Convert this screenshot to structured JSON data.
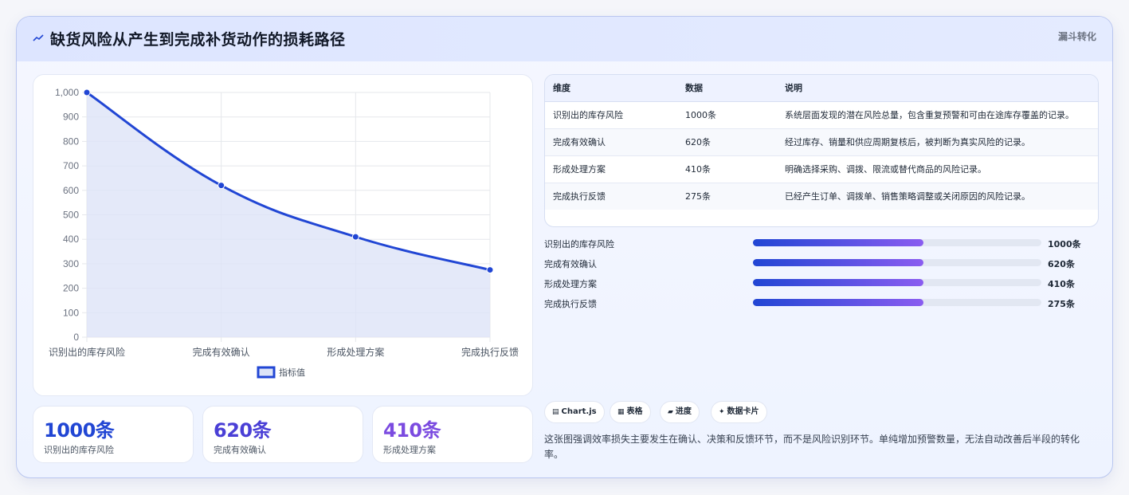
{
  "header": {
    "title": "缺货风险从产生到完成补货动作的损耗路径",
    "tag": "漏斗转化"
  },
  "colors": {
    "accent": "#2146d4",
    "accent_fill": "#dde4f7",
    "purple": "#7b4be0",
    "track": "#e2e7f2"
  },
  "chart_data": {
    "type": "line",
    "categories": [
      "识别出的库存风险",
      "完成有效确认",
      "形成处理方案",
      "完成执行反馈"
    ],
    "series": [
      {
        "name": "指标值",
        "values": [
          1000,
          620,
          410,
          275
        ]
      }
    ],
    "ylim": [
      0,
      1000
    ],
    "yticks": [
      "0",
      "100",
      "200",
      "300",
      "400",
      "500",
      "600",
      "700",
      "800",
      "900",
      "1,000"
    ],
    "fill": true,
    "grid": true,
    "legend": "bottom"
  },
  "kpis": [
    {
      "value": "1000条",
      "label": "识别出的库存风险",
      "color": "#2146d4"
    },
    {
      "value": "620条",
      "label": "完成有效确认",
      "color": "#4a3fd6"
    },
    {
      "value": "410条",
      "label": "形成处理方案",
      "color": "#7b4be0"
    }
  ],
  "table": {
    "headers": [
      "维度",
      "数据",
      "说明"
    ],
    "rows": [
      [
        "识别出的库存风险",
        "1000条",
        "系统层面发现的潜在风险总量，包含重复预警和可由在途库存覆盖的记录。"
      ],
      [
        "完成有效确认",
        "620条",
        "经过库存、销量和供应周期复核后，被判断为真实风险的记录。"
      ],
      [
        "形成处理方案",
        "410条",
        "明确选择采购、调拨、限流或替代商品的风险记录。"
      ],
      [
        "完成执行反馈",
        "275条",
        "已经产生订单、调拨单、销售策略调整或关闭原因的风险记录。"
      ]
    ]
  },
  "progress": [
    {
      "label": "识别出的库存风险",
      "value": "1000条",
      "fraction": 0.59
    },
    {
      "label": "完成有效确认",
      "value": "620条",
      "fraction": 0.59
    },
    {
      "label": "形成处理方案",
      "value": "410条",
      "fraction": 0.59
    },
    {
      "label": "完成执行反馈",
      "value": "275条",
      "fraction": 0.59
    }
  ],
  "chips": [
    {
      "label": "Chart.js",
      "icon": "chart-icon"
    },
    {
      "label": "表格",
      "icon": "table-icon"
    },
    {
      "label": "进度",
      "icon": "progress-icon"
    },
    {
      "label": "数据卡片",
      "icon": "sparkle-icon"
    }
  ],
  "insight": "这张图强调效率损失主要发生在确认、决策和反馈环节，而不是风险识别环节。单纯增加预警数量，无法自动改善后半段的转化率。"
}
